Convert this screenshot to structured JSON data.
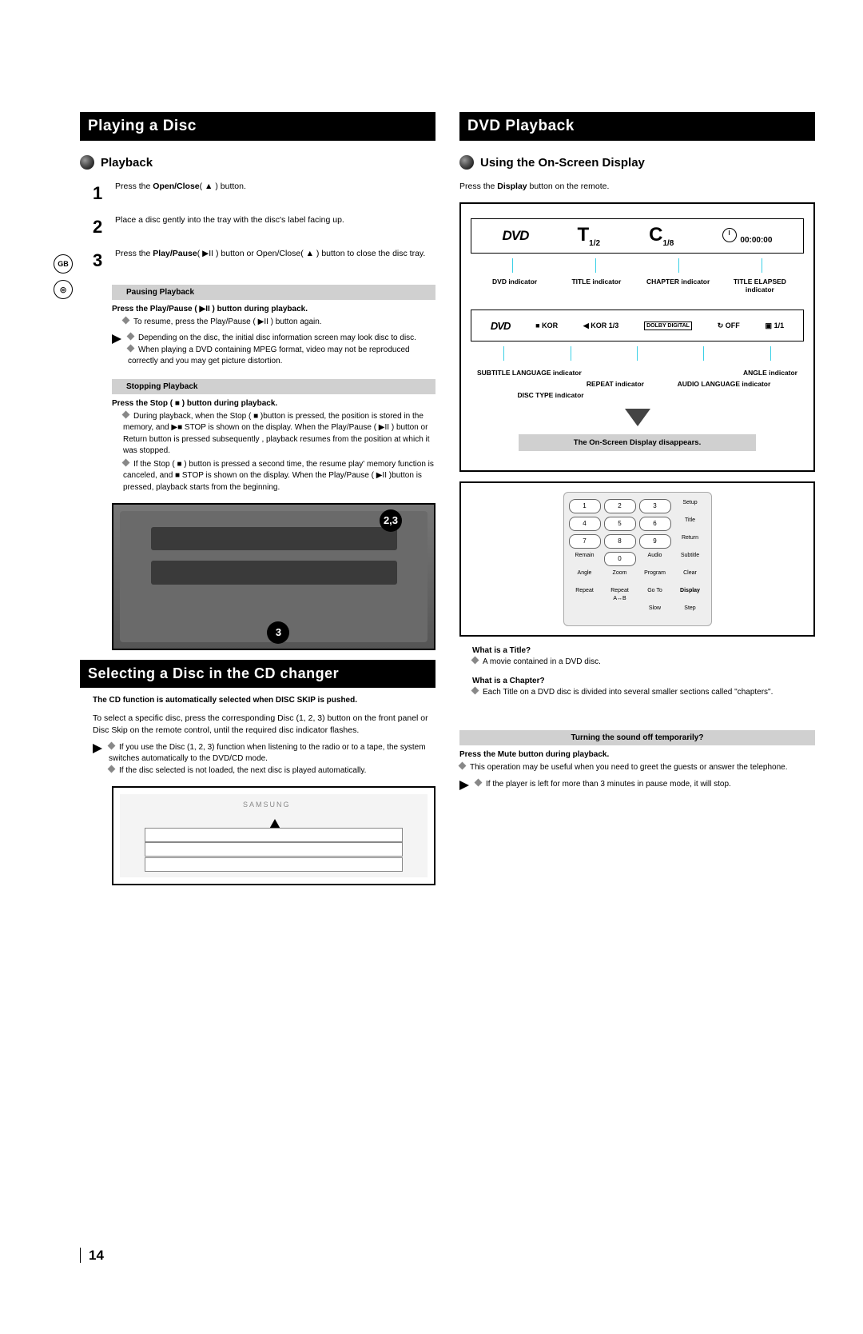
{
  "margin": {
    "gb": "GB",
    "disc": "◎"
  },
  "left": {
    "h1": "Playing a Disc",
    "h2": "Playback",
    "steps": [
      {
        "n": "1",
        "text_a": "Press the ",
        "bold": "Open/Close",
        "text_b": "(  ▲  ) button."
      },
      {
        "n": "2",
        "text_a": "Place a disc gently into the tray with the disc's label facing up.",
        "bold": "",
        "text_b": ""
      },
      {
        "n": "3",
        "text_a": "Press the ",
        "bold": "Play/Pause",
        "text_b": "( ▶II ) button or Open/Close( ▲ ) button to close the disc tray."
      }
    ],
    "pause_title": "Pausing Playback",
    "pause_bold": "Press the Play/Pause ( ▶II ) button during playback.",
    "pause_l1": "To resume, press the Play/Pause ( ▶II ) button again.",
    "pause_tri1": "Depending on the disc, the initial disc information screen may look disc to disc.",
    "pause_tri2": "When playing a DVD containing MPEG format, video may not be reproduced correctly and you may get picture distortion.",
    "stop_title": "Stopping Playback",
    "stop_bold": "Press the Stop ( ■ ) button during playback.",
    "stop_l1": "During playback, when the Stop ( ■ )button is pressed, the position is stored in the memory, and ▶■ STOP is shown on the display. When the Play/Pause ( ▶II ) button or Return button is pressed subsequently , playback resumes from the position at which it was stopped.",
    "stop_l2": "If the Stop ( ■ ) button is pressed a second time, the resume play' memory function is canceled, and ■ STOP is shown on the display. When the Play/Pause ( ▶II )button is pressed, playback starts from the beginning.",
    "callout1": "2,3",
    "callout2": "3",
    "h3": "Selecting a Disc in the CD changer",
    "cd_bold": "The CD function is automatically selected when DISC SKIP is pushed.",
    "cd_para": "To select a specific disc, press the corresponding Disc (1, 2, 3) button on the front panel or Disc Skip on the remote control, until the required disc indicator flashes.",
    "cd_tri1": "If you use the Disc (1, 2, 3) function when listening to the radio or to a tape, the system switches automatically to the DVD/CD mode.",
    "cd_tri2": "If the disc selected is not loaded, the next disc is played automatically.",
    "cd_brand": "SAMSUNG"
  },
  "right": {
    "h1": "DVD Playback",
    "h2": "Using the On-Screen Display",
    "intro_a": "Press the ",
    "intro_bold": "Display",
    "intro_b": " button on the remote.",
    "osd1": {
      "dvd": "DVD",
      "T": "T",
      "Tsub": "1/2",
      "C": "C",
      "Csub": "1/8",
      "time": "00:00:00"
    },
    "labels1": [
      "DVD indicator",
      "TITLE indicator",
      "CHAPTER indicator",
      "TITLE ELAPSED indicator"
    ],
    "osd2": {
      "dvd": "DVD",
      "a": "KOR",
      "b": "KOR 1/3",
      "c": "DOLBY DIGITAL",
      "d": "OFF",
      "e": "1/1"
    },
    "labels2_left": "SUBTITLE LANGUAGE indicator",
    "labels2_audio": "AUDIO LANGUAGE indicator",
    "labels2_disc": "DISC TYPE indicator",
    "labels2_angle": "ANGLE indicator",
    "labels2_repeat": "REPEAT indicator",
    "disappear": "The On-Screen Display disappears.",
    "remote_rows": [
      [
        "1",
        "2",
        "3",
        "Setup"
      ],
      [
        "4",
        "5",
        "6",
        "Title"
      ],
      [
        "7",
        "8",
        "9",
        "Return"
      ],
      [
        "Remain",
        "0",
        "Audio",
        "Subtitle"
      ],
      [
        "Angle",
        "Zoom",
        "Program",
        "Clear"
      ],
      [
        "Repeat",
        "Repeat A↔B",
        "Go To",
        "Display"
      ],
      [
        "",
        "",
        "Slow",
        "Step"
      ]
    ],
    "what_title_q": "What is a Title?",
    "what_title_a": "A movie contained in a DVD disc.",
    "what_chap_q": "What is a Chapter?",
    "what_chap_a": "Each Title on a DVD disc is divided into several smaller sections called \"chapters\".",
    "mute_title": "Turning the sound off temporarily?",
    "mute_bold": "Press the Mute button during playback.",
    "mute_l1": "This operation may be useful when you need to greet the guests or answer the telephone.",
    "mute_tri": "If the player is left for more than 3 minutes in pause mode, it will stop."
  },
  "page_number": "14"
}
